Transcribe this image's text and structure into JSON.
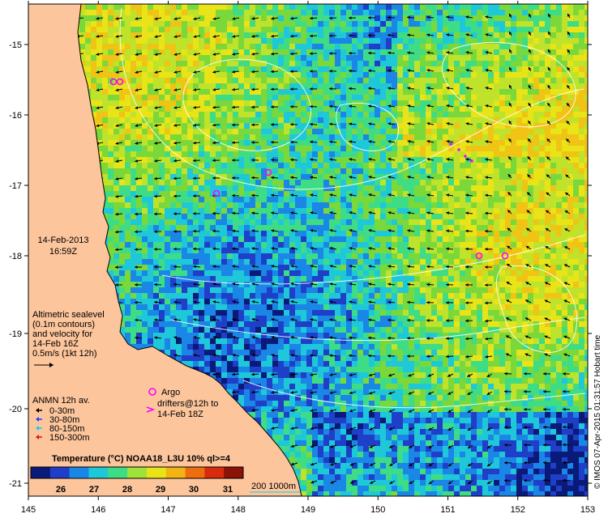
{
  "map": {
    "longitude_ticks": [
      "145",
      "146",
      "147",
      "148",
      "149",
      "150",
      "151",
      "152",
      "153"
    ],
    "latitude_ticks": [
      "-15",
      "-16",
      "-17",
      "-18",
      "-19",
      "-20",
      "-21"
    ],
    "date": "14-Feb-2013",
    "time": "16:59Z",
    "sealevel_note": [
      "Altimetric sealevel",
      "(0.1m contours)",
      "and velocity for",
      "14-Feb 16Z",
      "0.5m/s (1kt 12h)"
    ],
    "anmn_title": "ANMN 12h av.",
    "anmn_items": [
      {
        "label": "0-30m",
        "color": "#000000"
      },
      {
        "label": "30-80m",
        "color": "#1e3cff"
      },
      {
        "label": "80-150m",
        "color": "#00d2ff"
      },
      {
        "label": "150-300m",
        "color": "#e01010"
      }
    ],
    "argo_label": "Argo",
    "drifters_label": [
      "drifters@12h to",
      "14-Feb 18Z"
    ],
    "colorbar": {
      "title": "Temperature (°C) NOAA18_L3U 10% ql>=4",
      "ticks": [
        "26",
        "27",
        "28",
        "29",
        "30",
        "31"
      ],
      "colors": [
        "#0a1a78",
        "#1f3fc9",
        "#1a86e6",
        "#1fc8d8",
        "#3fdc86",
        "#9ee23a",
        "#e8e418",
        "#f2b414",
        "#ec6e10",
        "#d82a0c",
        "#8a1208"
      ]
    },
    "bathymetry_label": "200  1000m",
    "credit": "© IMOS 07-Apr-2015 01:31:57 Hobart time",
    "land_color": "#fcc59c",
    "argo_color": "#ff00ff"
  }
}
